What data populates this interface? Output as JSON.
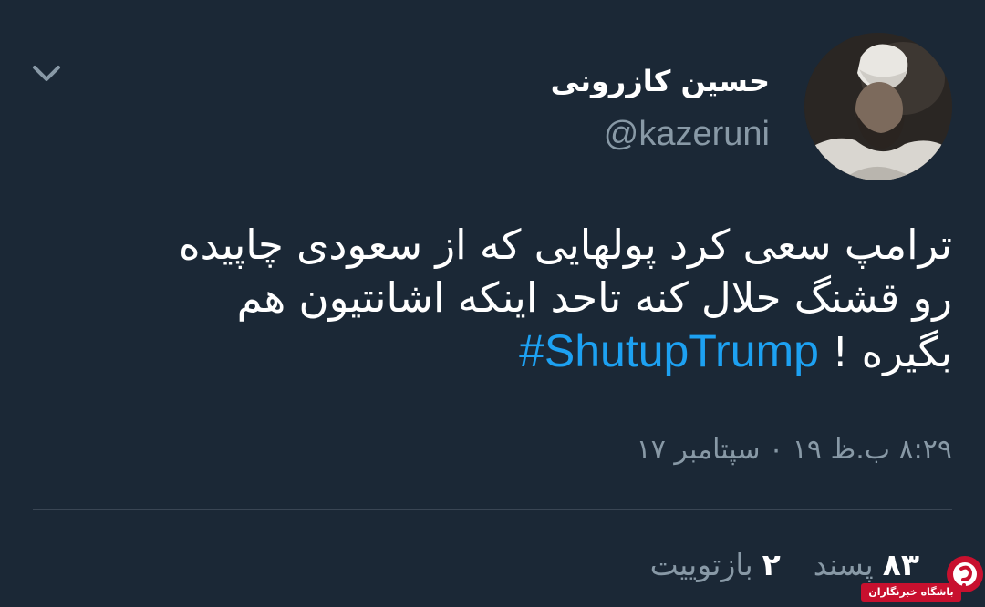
{
  "tweet": {
    "display_name": "حسین کازرونی",
    "handle": "@kazeruni",
    "text_lines": [
      "ترامپ سعی کرد پولهایی که از سعودی چاپیده",
      "رو قشنگ حلال کنه تاحد اینکه اشانتیون هم",
      "بگیره !"
    ],
    "hashtag": "#ShutupTrump",
    "timestamp": "۸:۲۹ ب.ظ ۱۹ ۰ سپتامبر ۱۷",
    "retweets_count": "۲",
    "retweets_label": "بازتوییت",
    "likes_count": "۸۳",
    "likes_label": "پسند"
  },
  "icons": {
    "menu": "chevron-down-icon",
    "avatar": "avatar-image",
    "watermark": "watermark-logo"
  },
  "watermark": {
    "text": "باشگاه خبرنگاران"
  },
  "colors": {
    "background": "#1b2836",
    "primary_text": "#ffffff",
    "secondary_text": "#8899a6",
    "hashtag": "#1da1f2",
    "divider": "#3a4654",
    "watermark_red": "#c8102e"
  }
}
